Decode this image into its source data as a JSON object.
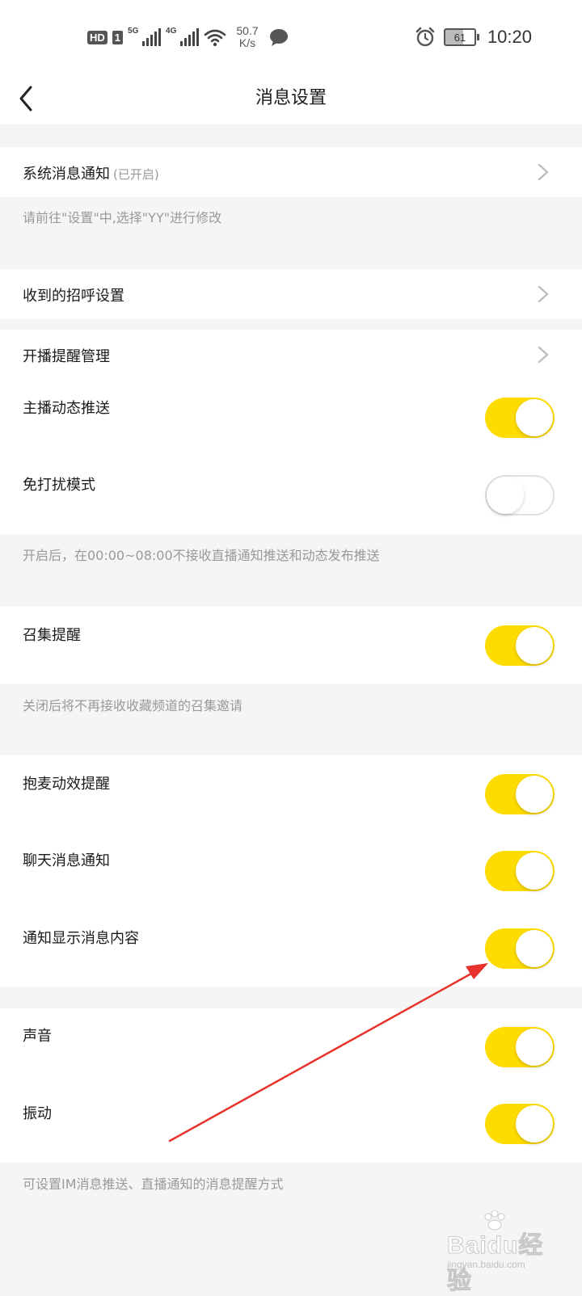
{
  "status_bar": {
    "hd": "HD",
    "sim": "1",
    "net_1": "5G",
    "net_2": "4G",
    "speed_value": "50.7",
    "speed_unit": "K/s",
    "battery": "61",
    "time": "10:20"
  },
  "header": {
    "title": "消息设置"
  },
  "system_notify": {
    "label": "系统消息通知",
    "status": "(已开启)",
    "hint": "请前往\"设置\"中,选择\"YY\"进行修改"
  },
  "greeting": {
    "label": "收到的招呼设置"
  },
  "live": {
    "reminder_label": "开播提醒管理",
    "anchor_push_label": "主播动态推送",
    "anchor_push_on": true,
    "dnd_label": "免打扰模式",
    "dnd_on": false,
    "dnd_hint": "开启后，在00:00~08:00不接收直播通知推送和动态发布推送"
  },
  "summon": {
    "label": "召集提醒",
    "on": true,
    "hint": "关闭后将不再接收收藏频道的召集邀请"
  },
  "messages": {
    "mic_effect_label": "抱麦动效提醒",
    "mic_effect_on": true,
    "chat_notify_label": "聊天消息通知",
    "chat_notify_on": true,
    "show_content_label": "通知显示消息内容",
    "show_content_on": true
  },
  "alerts": {
    "sound_label": "声音",
    "sound_on": true,
    "vibrate_label": "振动",
    "vibrate_on": true,
    "hint": "可设置IM消息推送、直播通知的消息提醒方式"
  },
  "colors": {
    "toggle_on": "#ffdc00",
    "annotation_arrow": "#e8322b"
  },
  "watermark": {
    "brand": "Baidu经验",
    "url": "jingyan.baidu.com"
  }
}
